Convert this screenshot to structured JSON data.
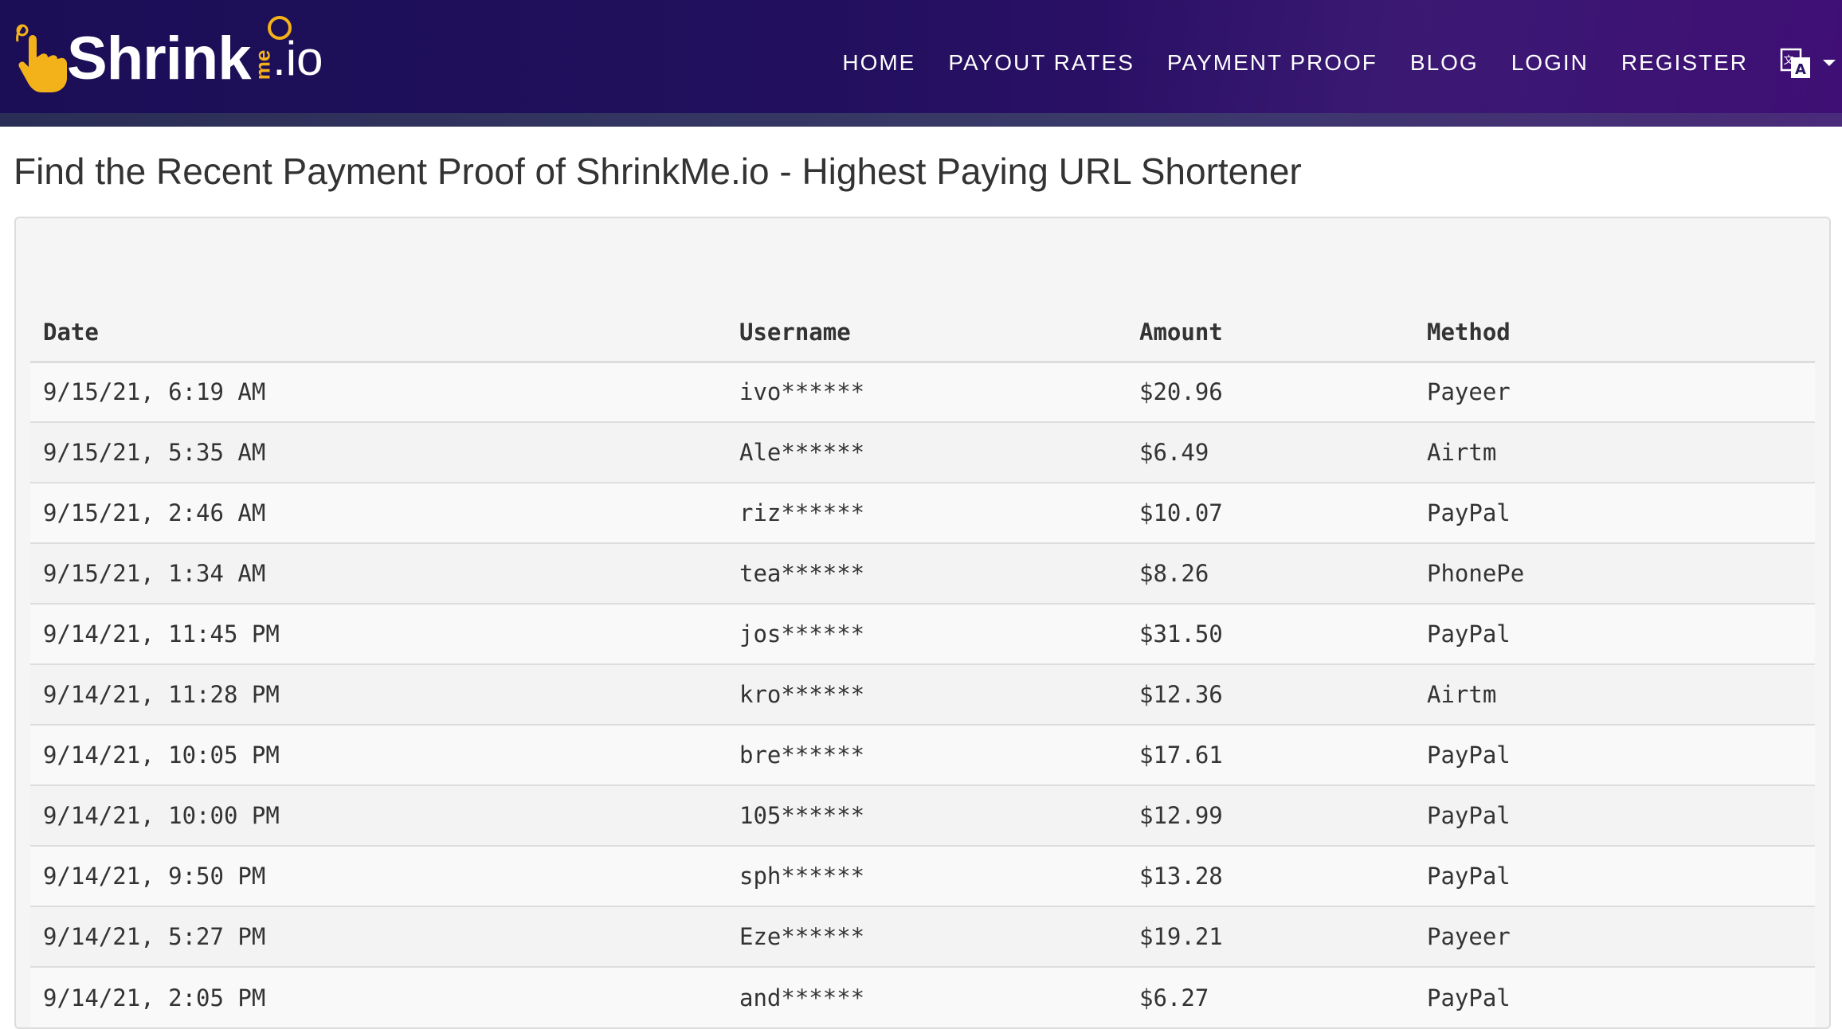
{
  "brand": {
    "word": "Shrink",
    "me": "me",
    "io": ".io",
    "accent": "#f3b21a"
  },
  "nav": {
    "items": [
      "HOME",
      "PAYOUT RATES",
      "PAYMENT PROOF",
      "BLOG",
      "LOGIN",
      "REGISTER"
    ],
    "language_icon": "translate-icon"
  },
  "page": {
    "title": "Find the Recent Payment Proof of ShrinkMe.io - Highest Paying URL Shortener"
  },
  "table": {
    "headers": [
      "Date",
      "Username",
      "Amount",
      "Method"
    ],
    "rows": [
      [
        "9/15/21, 6:19 AM",
        "ivo******",
        "$20.96",
        "Payeer"
      ],
      [
        "9/15/21, 5:35 AM",
        "Ale******",
        "$6.49",
        "Airtm"
      ],
      [
        "9/15/21, 2:46 AM",
        "riz******",
        "$10.07",
        "PayPal"
      ],
      [
        "9/15/21, 1:34 AM",
        "tea******",
        "$8.26",
        "PhonePe"
      ],
      [
        "9/14/21, 11:45 PM",
        "jos******",
        "$31.50",
        "PayPal"
      ],
      [
        "9/14/21, 11:28 PM",
        "kro******",
        "$12.36",
        "Airtm"
      ],
      [
        "9/14/21, 10:05 PM",
        "bre******",
        "$17.61",
        "PayPal"
      ],
      [
        "9/14/21, 10:00 PM",
        "105******",
        "$12.99",
        "PayPal"
      ],
      [
        "9/14/21, 9:50 PM",
        "sph******",
        "$13.28",
        "PayPal"
      ],
      [
        "9/14/21, 5:27 PM",
        "Eze******",
        "$19.21",
        "Payeer"
      ],
      [
        "9/14/21, 2:05 PM",
        "and******",
        "$6.27",
        "PayPal"
      ]
    ]
  }
}
